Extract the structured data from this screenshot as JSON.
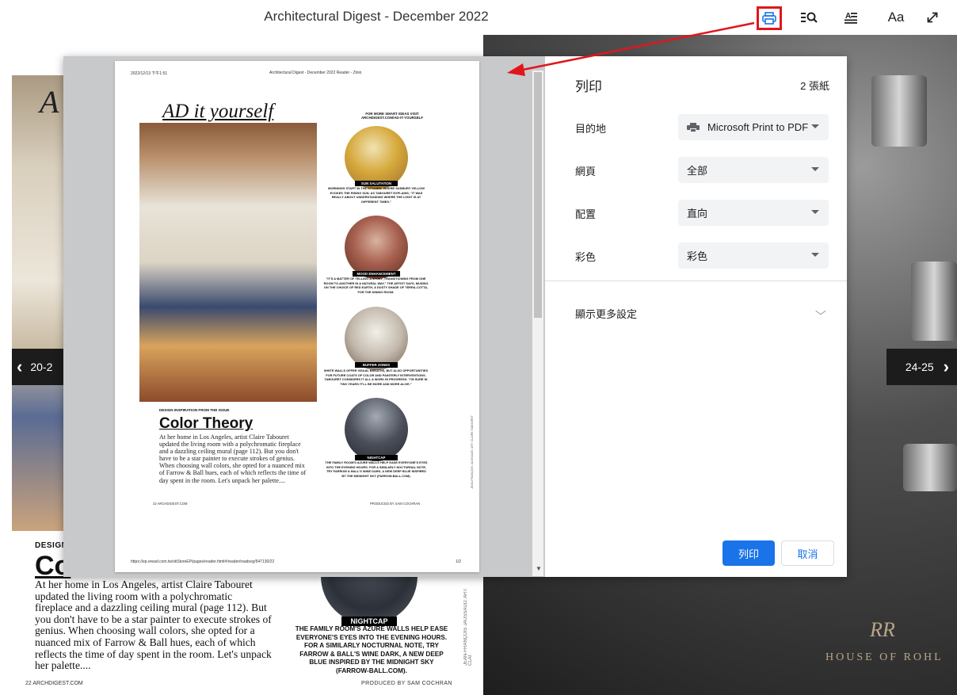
{
  "header": {
    "title": "Architectural Digest - December 2022",
    "font_button": "Aa"
  },
  "navigation": {
    "prev_label": "20-2",
    "next_label": "24-25"
  },
  "background_spread": {
    "left_heading_partial": "A",
    "design_label": "DESIGN",
    "title_partial": "Co",
    "article": "At her home in Los Angeles, artist Claire Tabouret updated the living room with a polychromatic fireplace and a dazzling ceiling mural (page 112). But you don't have to be a star painter to execute strokes of genius. When choosing wall colors, she opted for a nuanced mix of Farrow & Ball hues, each of which reflects the time of day spent in the room. Let's unpack her palette....",
    "nightcap_label": "NIGHTCAP",
    "nightcap_caption": "THE FAMILY ROOM'S AZURE WALLS HELP EASE EVERYONE'S EYES INTO THE EVENING HOURS. FOR A SIMILARLY NOCTURNAL NOTE, TRY FARROW & BALL'S WINE DARK, A NEW DEEP BLUE INSPIRED BY THE MIDNIGHT SKY (FARROW-BALL.COM).",
    "photo_credit_partial": "JEAN-FRANÇOIS JAUSSAUD; ART: CLAI",
    "footer_left": "22  ARCHDIGEST.COM",
    "footer_right": "PRODUCED BY SAM COCHRAN",
    "ad_monogram": "RR",
    "ad_brand": "HOUSE OF ROHL"
  },
  "print_preview": {
    "date": "2022/12/13 下午1:51",
    "page_header": "Architectural Digest - December 2022 Reader - Zinio",
    "heading": "AD it yourself",
    "more_ideas": "FOR MORE SMART IDEAS VISIT ARCHDIGEST.COM/AD-IT-YOURSELF",
    "design_label": "DESIGN INSPIRATION FROM THE ISSUE",
    "title": "Color Theory",
    "article": "At her home in Los Angeles, artist Claire Tabouret updated the living room with a polychromatic fireplace and a dazzling ceiling mural (page 112). But you don't have to be a star painter to execute strokes of genius. When choosing wall colors, she opted for a nuanced mix of Farrow & Ball hues, each of which reflects the time of day spent in the room. Let's unpack her palette....",
    "items": [
      {
        "label": "SUN SALUTATION",
        "caption": "MORNINGS START IN THE KITCHEN, WHERE SUDBURY YELLOW EVOKES THE RISING SUN. AS TABOURET EXPLAINS, \"IT WAS REALLY ABOUT UNDERSTANDING WHERE THE LIGHT IS AT DIFFERENT TIMES.\""
      },
      {
        "label": "MOOD ENHANCEMENT",
        "caption": "\"IT'S A MATTER OF TELLING A STORY, TRANSITIONING FROM ONE ROOM TO ANOTHER IN A NATURAL WAY,\" THE ARTIST SAYS, MUSING ON THE CHOICE OF RED EARTH, A DUSTY SHADE OF TERRA-COTTA, FOR THE DINING ROOM."
      },
      {
        "label": "BUFFER ZONES",
        "caption": "WHITE WALLS OFFER VISUAL BREATHS, BUT ALSO OPPORTUNITIES FOR FUTURE COATS OF COLOR AND PAINTERLY INTERVENTIONS. TABOURET CONSIDERS IT ALL A WORK IN PROGRESS: \"I'M SURE IN TWO YEARS IT'LL BE MORE AND MORE ALIVE.\""
      },
      {
        "label": "NIGHTCAP",
        "caption": "THE FAMILY ROOM'S AZURE WALLS HELP EASE EVERYONE'S EYES INTO THE EVENING HOURS. FOR A SIMILARLY NOCTURNAL NOTE, TRY FARROW & BALL'S WINE DARK, A NEW DEEP BLUE INSPIRED BY THE MIDNIGHT SKY (FARROW-BALL.COM)."
      }
    ],
    "photo_credit": "JEAN-FRANÇOIS JAUSSAUD; ART: CLAIRE TABOURET",
    "footer_left": "22  ARCHDIGEST.COM",
    "footer_right": "PRODUCED BY SAM COCHRAN",
    "url": "https://ep.eread.com.tw/stiStoreEP/pages/reader.html#/reader/readsvg/547130/22",
    "page_num": "1/2"
  },
  "print_settings": {
    "title": "列印",
    "sheet_count": "2 張紙",
    "destination_label": "目的地",
    "destination_value": "Microsoft Print to PDF",
    "pages_label": "網頁",
    "pages_value": "全部",
    "layout_label": "配置",
    "layout_value": "直向",
    "color_label": "彩色",
    "color_value": "彩色",
    "more_settings": "顯示更多設定",
    "print_button": "列印",
    "cancel_button": "取消"
  },
  "colors": {
    "accent": "#1a73e8",
    "highlight": "#e0161d"
  }
}
